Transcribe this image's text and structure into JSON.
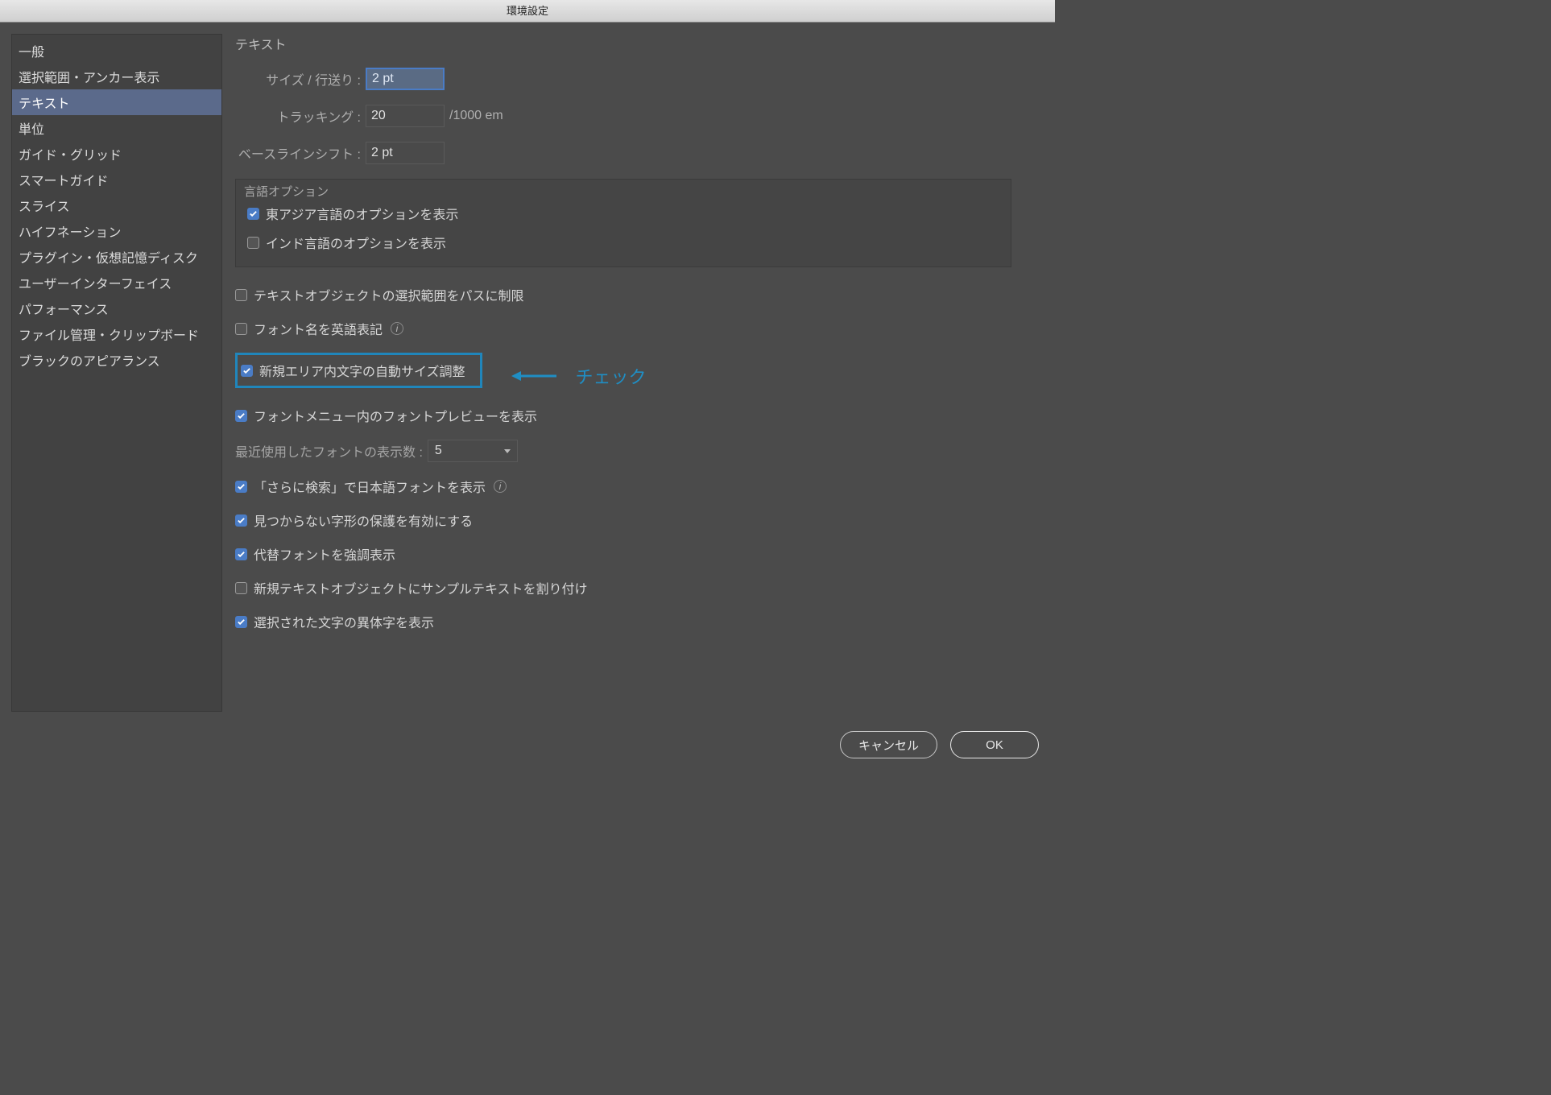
{
  "window": {
    "title": "環境設定"
  },
  "sidebar": {
    "items": [
      "一般",
      "選択範囲・アンカー表示",
      "テキスト",
      "単位",
      "ガイド・グリッド",
      "スマートガイド",
      "スライス",
      "ハイフネーション",
      "プラグイン・仮想記憶ディスク",
      "ユーザーインターフェイス",
      "パフォーマンス",
      "ファイル管理・クリップボード",
      "ブラックのアピアランス"
    ],
    "selected_index": 2
  },
  "main": {
    "title": "テキスト",
    "fields": {
      "size_leading": {
        "label": "サイズ / 行送り :",
        "value": "2 pt"
      },
      "tracking": {
        "label": "トラッキング :",
        "value": "20",
        "suffix": "/1000 em"
      },
      "baseline_shift": {
        "label": "ベースラインシフト :",
        "value": "2 pt"
      }
    },
    "language_group": {
      "title": "言語オプション",
      "east_asian": {
        "label": "東アジア言語のオプションを表示",
        "checked": true
      },
      "indic": {
        "label": "インド言語のオプションを表示",
        "checked": false
      }
    },
    "options": {
      "path_limit": {
        "label": "テキストオブジェクトの選択範囲をパスに制限",
        "checked": false
      },
      "font_english": {
        "label": "フォント名を英語表記",
        "checked": false,
        "info": true
      },
      "auto_size": {
        "label": "新規エリア内文字の自動サイズ調整",
        "checked": true
      },
      "font_preview": {
        "label": "フォントメニュー内のフォントプレビューを表示",
        "checked": true
      },
      "recent_fonts": {
        "label": "最近使用したフォントの表示数 :",
        "value": "5"
      },
      "show_japanese": {
        "label": "「さらに検索」で日本語フォントを表示",
        "checked": true,
        "info": true
      },
      "protect_glyph": {
        "label": "見つからない字形の保護を有効にする",
        "checked": true
      },
      "highlight_sub": {
        "label": "代替フォントを強調表示",
        "checked": true
      },
      "sample_text": {
        "label": "新規テキストオブジェクトにサンプルテキストを割り付け",
        "checked": false
      },
      "show_alternates": {
        "label": "選択された文字の異体字を表示",
        "checked": true
      }
    }
  },
  "annotation": {
    "text": "チェック"
  },
  "footer": {
    "cancel": "キャンセル",
    "ok": "OK"
  }
}
